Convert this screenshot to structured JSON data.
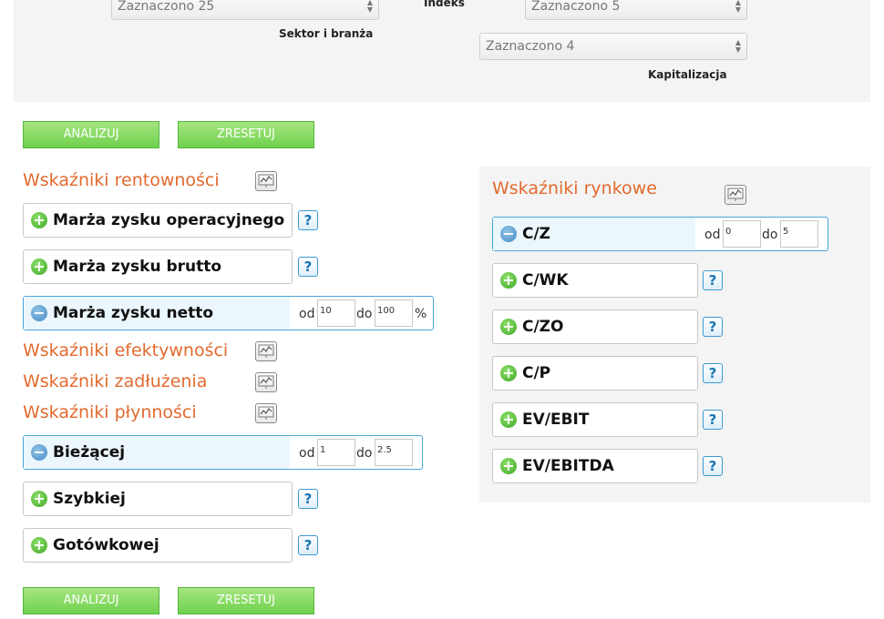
{
  "filters": {
    "sector_select": "Zaznaczono 25",
    "sector_label": "Sektor i branża",
    "index_label": "Indeks",
    "index_select": "Zaznaczono 5",
    "cap_select": "Zaznaczono 4",
    "cap_label": "Kapitalizacja"
  },
  "buttons": {
    "analyze": "ANALIZUJ",
    "reset": "ZRESETUJ"
  },
  "range": {
    "from": "od",
    "to": "do",
    "percent": "%"
  },
  "sections": {
    "profitability": "Wskaźniki rentowności",
    "efficiency": "Wskaźniki efektywności",
    "debt": "Wskaźniki zadłużenia",
    "liquidity": "Wskaźniki płynności",
    "market": "Wskaźniki rynkowe"
  },
  "profitability_items": [
    {
      "name": "Marża zysku operacyjnego",
      "active": false
    },
    {
      "name": "Marża zysku brutto",
      "active": false
    },
    {
      "name": "Marża zysku netto",
      "active": true,
      "from": "10",
      "to": "100"
    }
  ],
  "liquidity_items": [
    {
      "name": "Bieżącej",
      "active": true,
      "from": "1",
      "to": "2.5"
    },
    {
      "name": "Szybkiej",
      "active": false
    },
    {
      "name": "Gotówkowej",
      "active": false
    }
  ],
  "market_items": [
    {
      "name": "C/Z",
      "active": true,
      "from": "0",
      "to": "5"
    },
    {
      "name": "C/WK",
      "active": false
    },
    {
      "name": "C/ZO",
      "active": false
    },
    {
      "name": "C/P",
      "active": false
    },
    {
      "name": "EV/EBIT",
      "active": false
    },
    {
      "name": "EV/EBITDA",
      "active": false
    }
  ],
  "icons": {
    "expand": "plus-circle-icon",
    "collapse": "minus-circle-icon",
    "help": "question-mark-icon",
    "chart": "chart-icon"
  },
  "help_symbol": "?",
  "colors": {
    "accent_orange": "#e26a2e",
    "button_green": "#6fd14f",
    "active_blue": "#4aa6dc"
  }
}
